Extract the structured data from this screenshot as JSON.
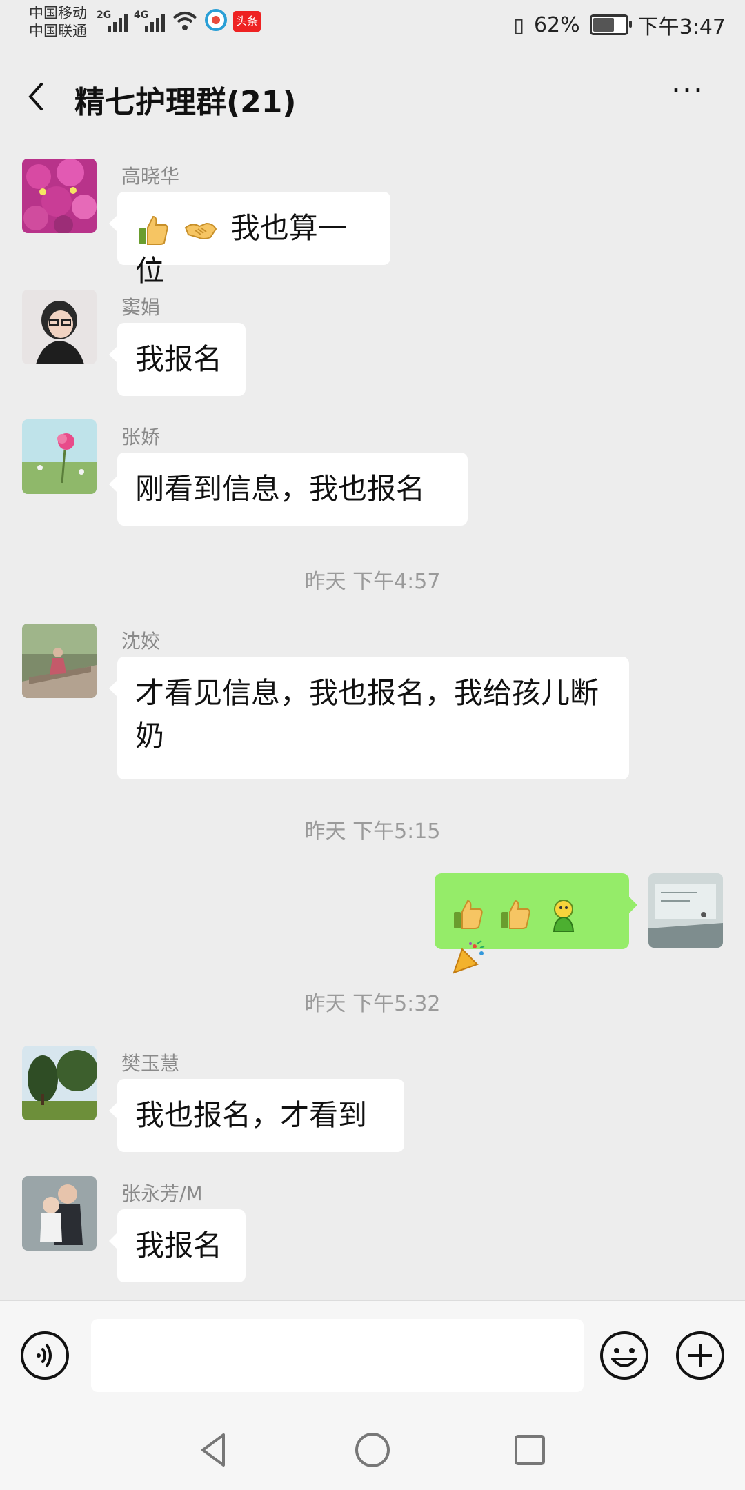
{
  "status_bar": {
    "carrier1": "中国移动",
    "carrier2": "中国联通",
    "net1": "2G",
    "net2": "4G",
    "battery_percent": "62%",
    "battery_level": 0.62,
    "time": "下午3:47",
    "news_app_label": "头条"
  },
  "header": {
    "title": "精七护理群(21)",
    "more": "···"
  },
  "messages": [
    {
      "sender": "高晓华",
      "text": "我也算一位",
      "emoji": [
        "thumbs-up",
        "handshake"
      ]
    },
    {
      "sender": "窦娟",
      "text": "我报名"
    },
    {
      "sender": "张娇",
      "text": "刚看到信息，我也报名"
    },
    {
      "sender": "沈姣",
      "text": "才看见信息，我也报名，我给孩儿断奶"
    },
    {
      "sender": "樊玉慧",
      "text": "我也报名，才看到"
    },
    {
      "sender": "张永芳/M",
      "text": "我报名"
    }
  ],
  "timestamps": [
    "昨天 下午4:57",
    "昨天 下午5:15",
    "昨天 下午5:32"
  ],
  "my_message": {
    "emoji": [
      "thumbs-up",
      "thumbs-up",
      "green-figure",
      "party-popper"
    ],
    "bubble_color": "#95ec69"
  },
  "input_bar": {
    "placeholder": ""
  },
  "colors": {
    "background": "#ededed",
    "bubble_in": "#ffffff",
    "bubble_out": "#95ec69",
    "meta_text": "#9a9a9a"
  }
}
